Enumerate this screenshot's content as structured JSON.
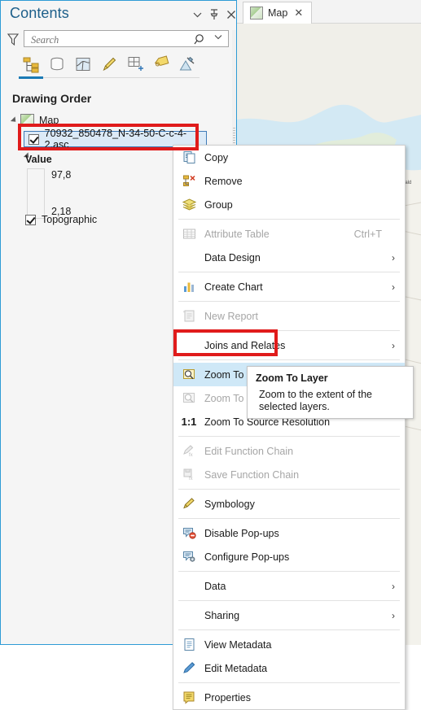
{
  "pane": {
    "title": "Contents",
    "header_buttons": [
      {
        "name": "menu",
        "glyph": "∨"
      },
      {
        "name": "pin",
        "glyph": "⤒"
      },
      {
        "name": "close",
        "glyph": "✕"
      }
    ],
    "search": {
      "placeholder": "Search",
      "value": ""
    },
    "toolbar": [
      {
        "name": "list-by-drawing-order",
        "label": "List By Drawing Order",
        "active": true
      },
      {
        "name": "list-by-data-source",
        "label": "List By Data Source",
        "active": false
      },
      {
        "name": "list-by-selection",
        "label": "List By Selection",
        "active": false
      },
      {
        "name": "list-by-editing",
        "label": "List By Editing",
        "active": false
      },
      {
        "name": "list-by-snapping",
        "label": "List By Snapping",
        "active": false
      },
      {
        "name": "list-by-labeling",
        "label": "List By Labeling",
        "active": false
      },
      {
        "name": "list-by-diagram",
        "label": "List By Diagram",
        "active": false
      }
    ],
    "section_header": "Drawing Order",
    "tree": {
      "map_node": "Map",
      "layer_name": "70932_850478_N-34-50-C-c-4-2.asc",
      "layer_checked": true,
      "legend": {
        "title": "Value",
        "max": "97,8",
        "min": "2,18"
      },
      "basemap": "Topographic",
      "basemap_checked": true
    }
  },
  "map_view": {
    "tab_label": "Map",
    "tab_close": "✕"
  },
  "context_menu": {
    "items": [
      {
        "label": "Copy",
        "icon": "copy-icon",
        "disabled": false,
        "shortcut": "",
        "submenu": false,
        "highlighted": false,
        "separator_after": false
      },
      {
        "label": "Remove",
        "icon": "remove-icon",
        "disabled": false,
        "shortcut": "",
        "submenu": false,
        "highlighted": false,
        "separator_after": false
      },
      {
        "label": "Group",
        "icon": "group-icon",
        "disabled": false,
        "shortcut": "",
        "submenu": false,
        "highlighted": false,
        "separator_after": true
      },
      {
        "label": "Attribute Table",
        "icon": "table-icon",
        "disabled": true,
        "shortcut": "Ctrl+T",
        "submenu": false,
        "highlighted": false,
        "separator_after": false
      },
      {
        "label": "Data Design",
        "icon": "",
        "disabled": false,
        "shortcut": "",
        "submenu": true,
        "highlighted": false,
        "separator_after": true
      },
      {
        "label": "Create Chart",
        "icon": "chart-icon",
        "disabled": false,
        "shortcut": "",
        "submenu": true,
        "highlighted": false,
        "separator_after": true
      },
      {
        "label": "New Report",
        "icon": "report-icon",
        "disabled": true,
        "shortcut": "",
        "submenu": false,
        "highlighted": false,
        "separator_after": true
      },
      {
        "label": "Joins and Relates",
        "icon": "",
        "disabled": false,
        "shortcut": "",
        "submenu": true,
        "highlighted": false,
        "separator_after": true
      },
      {
        "label": "Zoom To Layer",
        "icon": "zoom-layer-icon",
        "disabled": false,
        "shortcut": "",
        "submenu": false,
        "highlighted": true,
        "separator_after": false
      },
      {
        "label": "Zoom To Source",
        "icon": "zoom-source-icon",
        "disabled": true,
        "shortcut": "",
        "submenu": false,
        "highlighted": false,
        "separator_after": false
      },
      {
        "label": "Zoom To Source Resolution",
        "icon": "one-to-one-icon",
        "disabled": false,
        "shortcut": "",
        "submenu": false,
        "highlighted": false,
        "separator_after": true
      },
      {
        "label": "Edit Function Chain",
        "icon": "edit-function-icon",
        "disabled": true,
        "shortcut": "",
        "submenu": false,
        "highlighted": false,
        "separator_after": false
      },
      {
        "label": "Save Function Chain",
        "icon": "save-function-icon",
        "disabled": true,
        "shortcut": "",
        "submenu": false,
        "highlighted": false,
        "separator_after": true
      },
      {
        "label": "Symbology",
        "icon": "symbology-icon",
        "disabled": false,
        "shortcut": "",
        "submenu": false,
        "highlighted": false,
        "separator_after": true
      },
      {
        "label": "Disable Pop-ups",
        "icon": "disable-popup-icon",
        "disabled": false,
        "shortcut": "",
        "submenu": false,
        "highlighted": false,
        "separator_after": false
      },
      {
        "label": "Configure Pop-ups",
        "icon": "configure-popup-icon",
        "disabled": false,
        "shortcut": "",
        "submenu": false,
        "highlighted": false,
        "separator_after": true
      },
      {
        "label": "Data",
        "icon": "",
        "disabled": false,
        "shortcut": "",
        "submenu": true,
        "highlighted": false,
        "separator_after": true
      },
      {
        "label": "Sharing",
        "icon": "",
        "disabled": false,
        "shortcut": "",
        "submenu": true,
        "highlighted": false,
        "separator_after": true
      },
      {
        "label": "View Metadata",
        "icon": "view-metadata-icon",
        "disabled": false,
        "shortcut": "",
        "submenu": false,
        "highlighted": false,
        "separator_after": false
      },
      {
        "label": "Edit Metadata",
        "icon": "edit-metadata-icon",
        "disabled": false,
        "shortcut": "",
        "submenu": false,
        "highlighted": false,
        "separator_after": true
      },
      {
        "label": "Properties",
        "icon": "properties-icon",
        "disabled": false,
        "shortcut": "",
        "submenu": false,
        "highlighted": false,
        "separator_after": false
      }
    ],
    "submenu_glyph": "›"
  },
  "tooltip": {
    "title": "Zoom To Layer",
    "body": "Zoom to the extent of the selected layers."
  },
  "colors": {
    "accent": "#2e9bd6",
    "title": "#1d5f8a",
    "highlight": "#cfe8f7",
    "annotation": "#e01b1b",
    "selection": "#dceaf7"
  }
}
